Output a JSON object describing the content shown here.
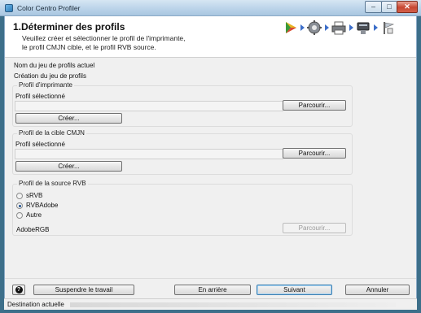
{
  "window": {
    "title": "Color Centro Profiler",
    "controls": {
      "minimize": "–",
      "maximize": "□",
      "close": "✕"
    }
  },
  "header": {
    "title": "1.Déterminer des profils",
    "description_line1": "Veuillez créer et sélectionner le profil de l'imprimante,",
    "description_line2": "le profil CMJN cible, et le profil RVB source.",
    "step_icons": [
      "play-step-icon",
      "gear-step-icon",
      "printer-step-icon",
      "scanner-step-icon",
      "flag-step-icon"
    ]
  },
  "profile_set": {
    "label": "Nom du jeu de profils actuel",
    "value": "Création du jeu de profils"
  },
  "printer_profile": {
    "title": "Profil d'imprimante",
    "selected_label": "Profil sélectionné",
    "field_value": "",
    "browse": "Parcourir...",
    "create": "Créer..."
  },
  "cmyk_target": {
    "title": "Profil de la cible CMJN",
    "selected_label": "Profil sélectionné",
    "field_value": "",
    "browse": "Parcourir...",
    "create": "Créer..."
  },
  "rgb_source": {
    "title": "Profil de la source RVB",
    "options": [
      {
        "label": "sRVB",
        "checked": false
      },
      {
        "label": "RVBAdobe",
        "checked": true
      },
      {
        "label": "Autre",
        "checked": false
      }
    ],
    "current_value": "AdobeRGB",
    "browse": "Parcourir..."
  },
  "footer": {
    "help": "?",
    "suspend": "Suspendre le travail",
    "back": "En arrière",
    "next": "Suivant",
    "cancel": "Annuler"
  },
  "status": {
    "label": "Destination actuelle"
  }
}
